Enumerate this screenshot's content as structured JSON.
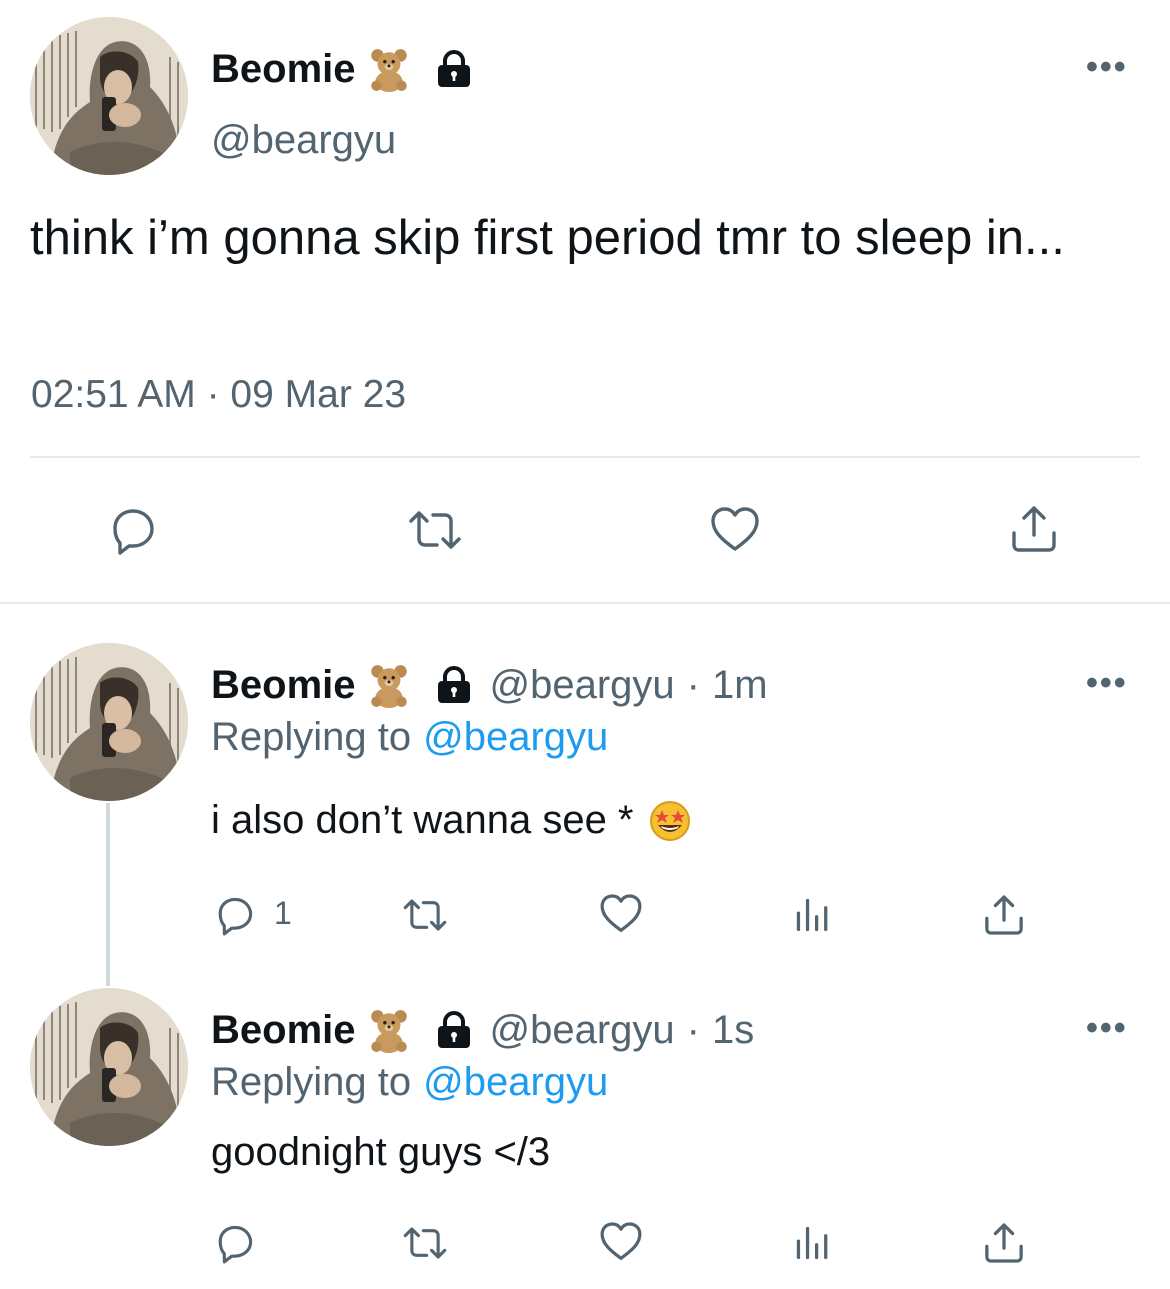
{
  "main_tweet": {
    "display_name": "Beomie",
    "name_emoji": "teddy-bear-emoji",
    "protected_icon": "lock-icon",
    "handle": "@beargyu",
    "text": "think i’m gonna skip first period tmr to sleep in...",
    "timestamp": "02:51 AM · 09 Mar 23",
    "actions": [
      "reply-icon",
      "retweet-icon",
      "like-icon",
      "share-icon"
    ]
  },
  "replies": [
    {
      "display_name": "Beomie",
      "handle": "@beargyu",
      "separator": "·",
      "time": "1m",
      "replying_prefix": "Replying to",
      "replying_to": "@beargyu",
      "text": "i also don’t wanna see *",
      "text_emoji": "star-struck-emoji",
      "reply_count": "1",
      "actions": [
        "reply-icon",
        "retweet-icon",
        "like-icon",
        "analytics-icon",
        "share-icon"
      ]
    },
    {
      "display_name": "Beomie",
      "handle": "@beargyu",
      "separator": "·",
      "time": "1s",
      "replying_prefix": "Replying to",
      "replying_to": "@beargyu",
      "text": "goodnight guys </3",
      "reply_count": "",
      "actions": [
        "reply-icon",
        "retweet-icon",
        "like-icon",
        "analytics-icon",
        "share-icon"
      ]
    }
  ],
  "colors": {
    "text": "#0f1419",
    "secondary": "#536471",
    "link": "#1d9bf0",
    "divider": "#e6e8ea"
  }
}
